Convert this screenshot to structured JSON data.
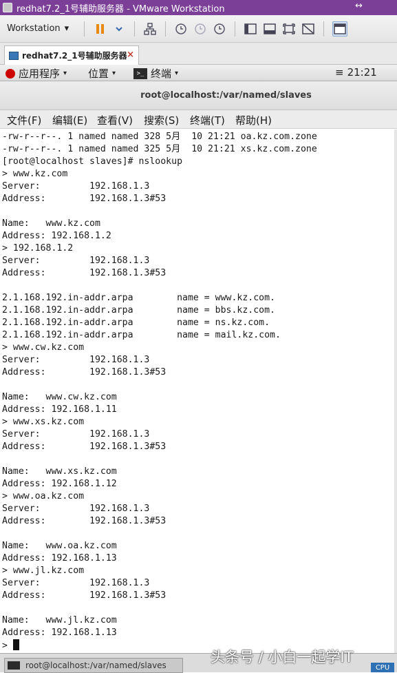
{
  "window": {
    "title": "redhat7.2_1号辅助服务器 - VMware Workstation",
    "resize_glyph": "↔"
  },
  "toolbar": {
    "workstation_menu": "Workstation",
    "caret": "▾"
  },
  "tabs": [
    {
      "label": "redhat7.2_1号辅助服务器",
      "close": "×"
    }
  ],
  "gnome": {
    "applications": "应用程序",
    "places": "位置",
    "terminal": "终端",
    "terminal_icon_text": ">_",
    "clock": "21:21",
    "menu_glyph": "≡",
    "caret": "▾"
  },
  "terminal": {
    "title": "root@localhost:/var/named/slaves",
    "menu": [
      "文件(F)",
      "编辑(E)",
      "查看(V)",
      "搜索(S)",
      "终端(T)",
      "帮助(H)"
    ],
    "lines": [
      "-rw-r--r--. 1 named named 328 5月  10 21:21 oa.kz.com.zone",
      "-rw-r--r--. 1 named named 325 5月  10 21:21 xs.kz.com.zone",
      "[root@localhost slaves]# nslookup",
      "> www.kz.com",
      "Server:         192.168.1.3",
      "Address:        192.168.1.3#53",
      "",
      "Name:   www.kz.com",
      "Address: 192.168.1.2",
      "> 192.168.1.2",
      "Server:         192.168.1.3",
      "Address:        192.168.1.3#53",
      "",
      "2.1.168.192.in-addr.arpa        name = www.kz.com.",
      "2.1.168.192.in-addr.arpa        name = bbs.kz.com.",
      "2.1.168.192.in-addr.arpa        name = ns.kz.com.",
      "2.1.168.192.in-addr.arpa        name = mail.kz.com.",
      "> www.cw.kz.com",
      "Server:         192.168.1.3",
      "Address:        192.168.1.3#53",
      "",
      "Name:   www.cw.kz.com",
      "Address: 192.168.1.11",
      "> www.xs.kz.com",
      "Server:         192.168.1.3",
      "Address:        192.168.1.3#53",
      "",
      "Name:   www.xs.kz.com",
      "Address: 192.168.1.12",
      "> www.oa.kz.com",
      "Server:         192.168.1.3",
      "Address:        192.168.1.3#53",
      "",
      "Name:   www.oa.kz.com",
      "Address: 192.168.1.13",
      "> www.jl.kz.com",
      "Server:         192.168.1.3",
      "Address:        192.168.1.3#53",
      "",
      "Name:   www.jl.kz.com",
      "Address: 192.168.1.13"
    ],
    "prompt": "> "
  },
  "taskbar": {
    "item": "root@localhost:/var/named/slaves"
  },
  "watermark": "头条号 / 小白一起学IT",
  "cpu_badge": "CPU"
}
